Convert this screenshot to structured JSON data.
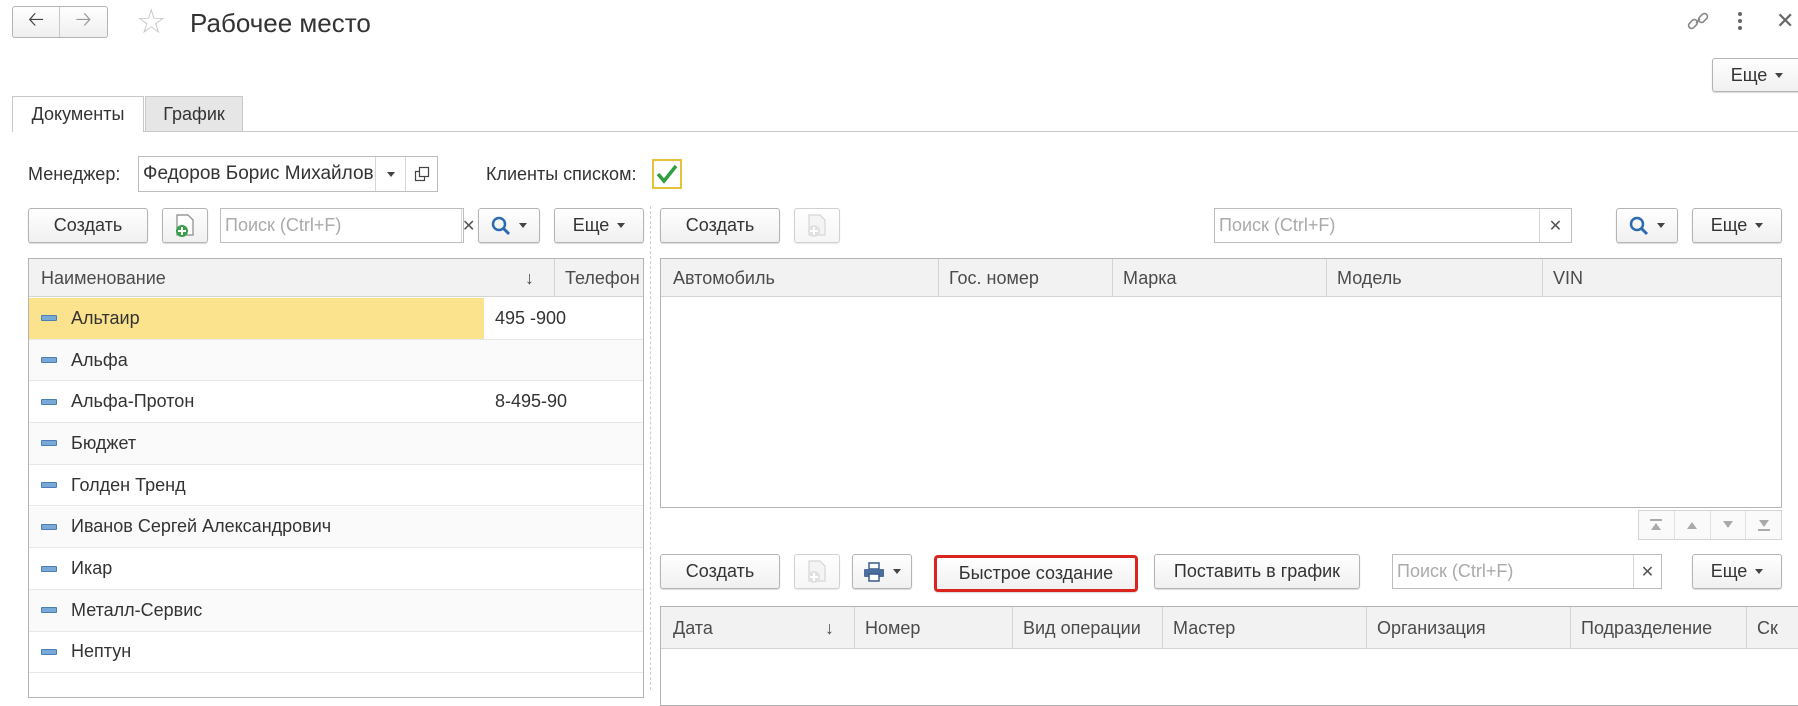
{
  "window": {
    "title": "Рабочее место",
    "more_label": "Еще"
  },
  "tabs": [
    {
      "label": "Документы",
      "active": true
    },
    {
      "label": "График",
      "active": false
    }
  ],
  "filters": {
    "manager_label": "Менеджер:",
    "manager_value": "Федоров Борис Михайлович",
    "clients_list_label": "Клиенты списком:",
    "clients_list_checked": true
  },
  "clients_panel": {
    "create_label": "Создать",
    "search_placeholder": "Поиск (Ctrl+F)",
    "more_label": "Еще",
    "columns": [
      "Наименование",
      "Телефон"
    ],
    "rows": [
      {
        "name": "Альтаир",
        "phone": "495 -900",
        "selected": true
      },
      {
        "name": "Альфа",
        "phone": ""
      },
      {
        "name": "Альфа-Протон",
        "phone": "8-495-90"
      },
      {
        "name": "Бюджет",
        "phone": ""
      },
      {
        "name": "Голден Тренд",
        "phone": ""
      },
      {
        "name": "Иванов Сергей Александрович",
        "phone": ""
      },
      {
        "name": "Икар",
        "phone": ""
      },
      {
        "name": "Металл-Сервис",
        "phone": ""
      },
      {
        "name": "Нептун",
        "phone": ""
      }
    ]
  },
  "cars_panel": {
    "create_label": "Создать",
    "search_placeholder": "Поиск (Ctrl+F)",
    "more_label": "Еще",
    "columns": [
      "Автомобиль",
      "Гос. номер",
      "Марка",
      "Модель",
      "VIN"
    ]
  },
  "docs_panel": {
    "create_label": "Создать",
    "quick_create_label": "Быстрое создание",
    "schedule_label": "Поставить в график",
    "search_placeholder": "Поиск (Ctrl+F)",
    "more_label": "Еще",
    "columns": [
      "Дата",
      "Номер",
      "Вид операции",
      "Мастер",
      "Организация",
      "Подразделение",
      "Ск"
    ],
    "highlight_color": "#d9251d"
  },
  "colors": {
    "selected_row": "#fbe38e",
    "checkbox_check": "#2e9e3e",
    "checkbox_border": "#e5c23a"
  }
}
